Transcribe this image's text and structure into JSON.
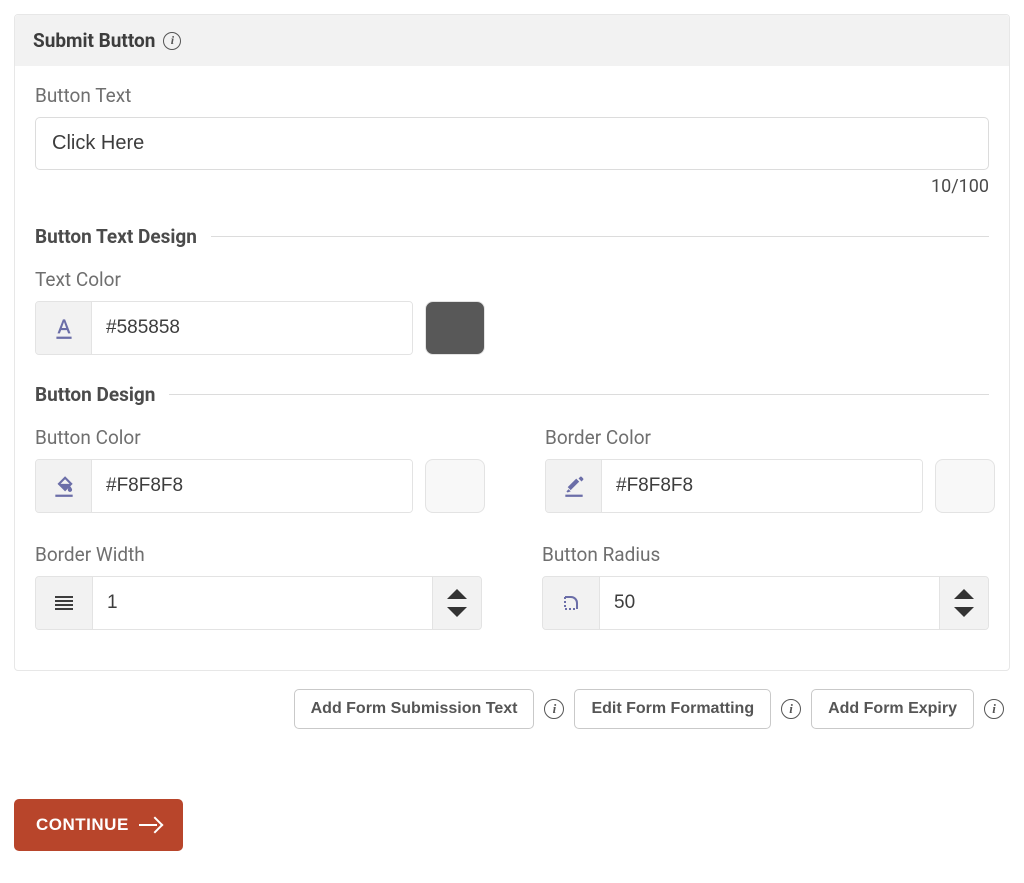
{
  "panel": {
    "title": "Submit Button"
  },
  "buttonText": {
    "label": "Button Text",
    "value": "Click Here",
    "counter": "10/100"
  },
  "sections": {
    "textDesign": "Button Text Design",
    "buttonDesign": "Button Design"
  },
  "textColor": {
    "label": "Text Color",
    "value": "#585858",
    "swatch": "#585858"
  },
  "buttonColor": {
    "label": "Button Color",
    "value": "#F8F8F8",
    "swatch": "#F8F8F8"
  },
  "borderColor": {
    "label": "Border Color",
    "value": "#F8F8F8",
    "swatch": "#F8F8F8"
  },
  "borderWidth": {
    "label": "Border Width",
    "value": "1"
  },
  "buttonRadius": {
    "label": "Button Radius",
    "value": "50"
  },
  "actions": {
    "addSubmissionText": "Add Form Submission Text",
    "editFormatting": "Edit Form Formatting",
    "addFormExpiry": "Add Form Expiry"
  },
  "continueLabel": "CONTINUE"
}
